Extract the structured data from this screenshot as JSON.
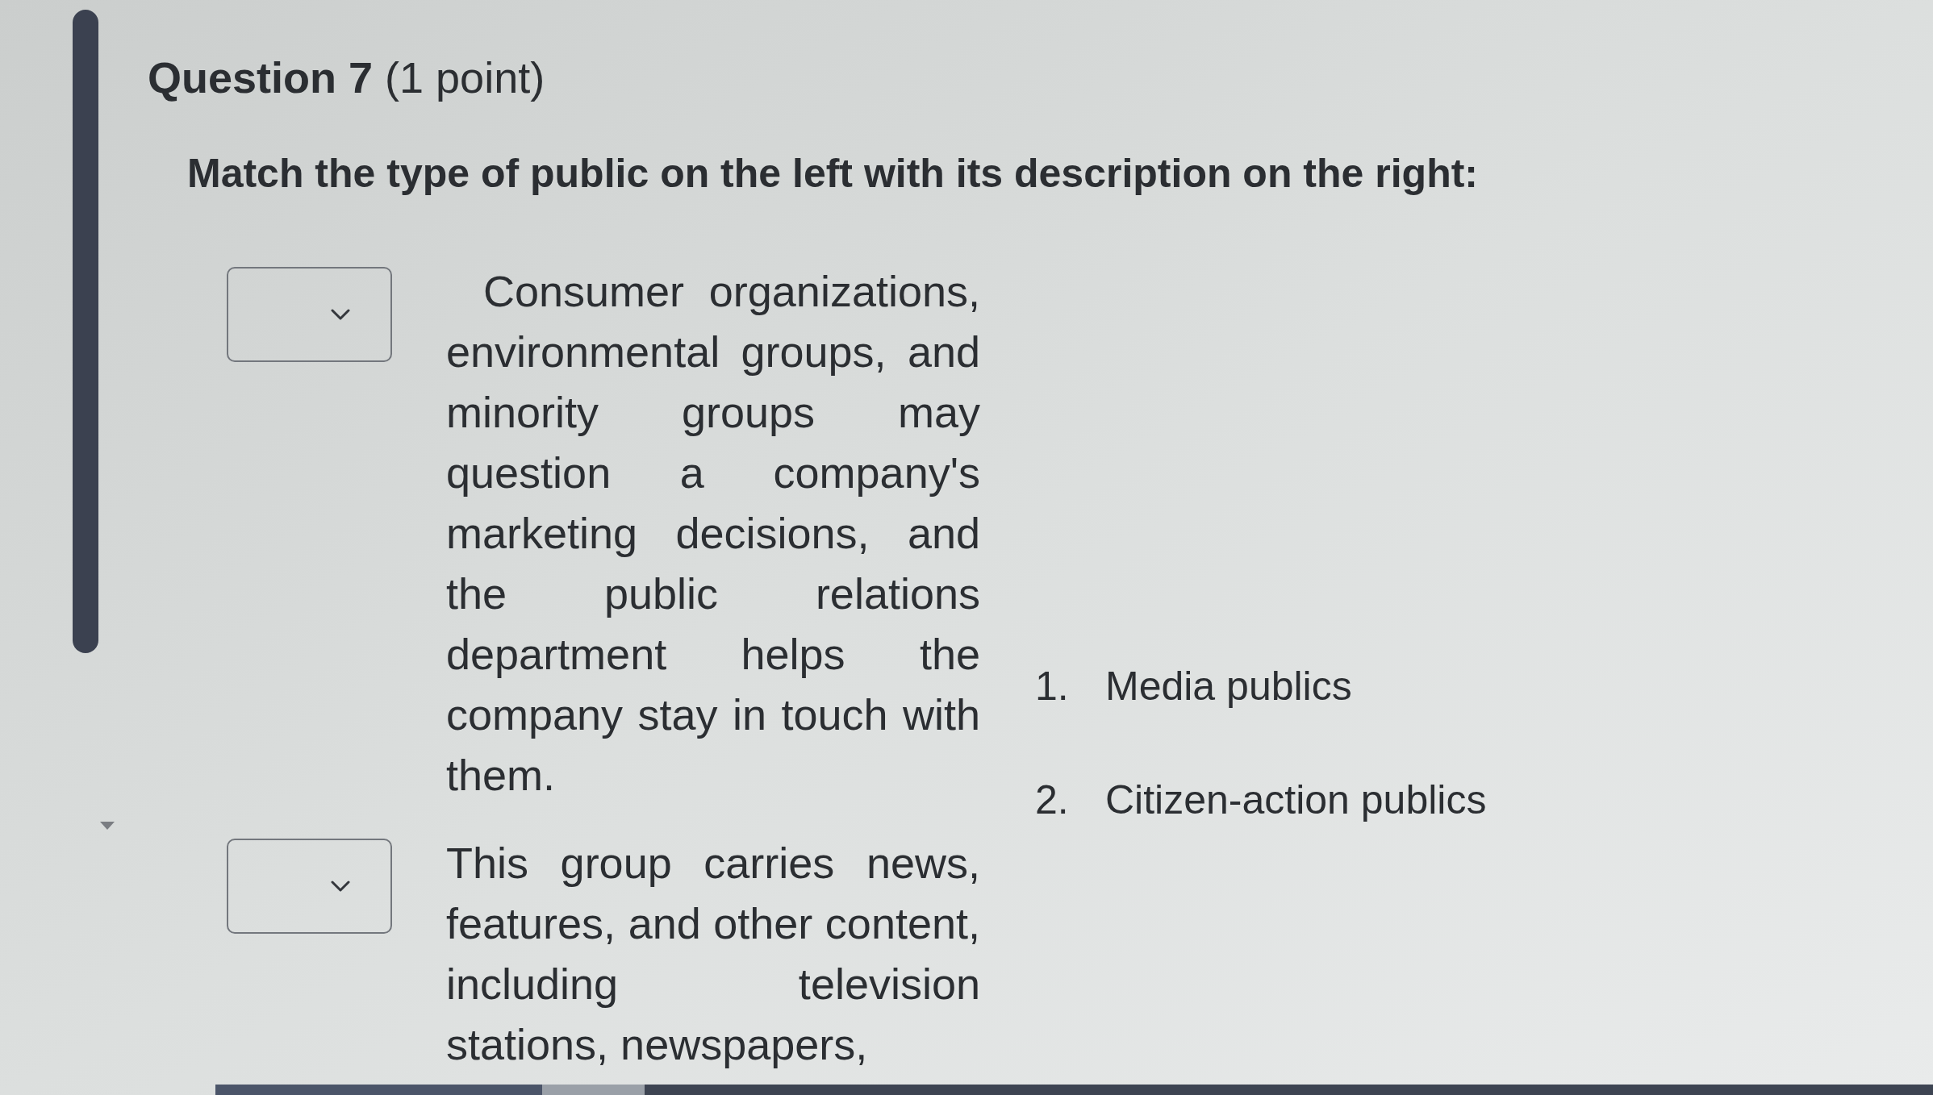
{
  "question": {
    "title": "**Question 7** (1 point)",
    "prompt": "Match the type of public on the left with its description on the right:"
  },
  "matches": [
    {
      "description": "Consumer organizations, environmental groups, and minority groups may question a company's marketing decisions, and the public relations department helps the company stay in touch with them.",
      "indented": true
    },
    {
      "description": "This group carries news, features, and other content, including television stations, newspapers,",
      "indented": false
    }
  ],
  "options": [
    {
      "number": "1.",
      "label": "Media publics"
    },
    {
      "number": "2.",
      "label": "Citizen-action publics"
    }
  ]
}
